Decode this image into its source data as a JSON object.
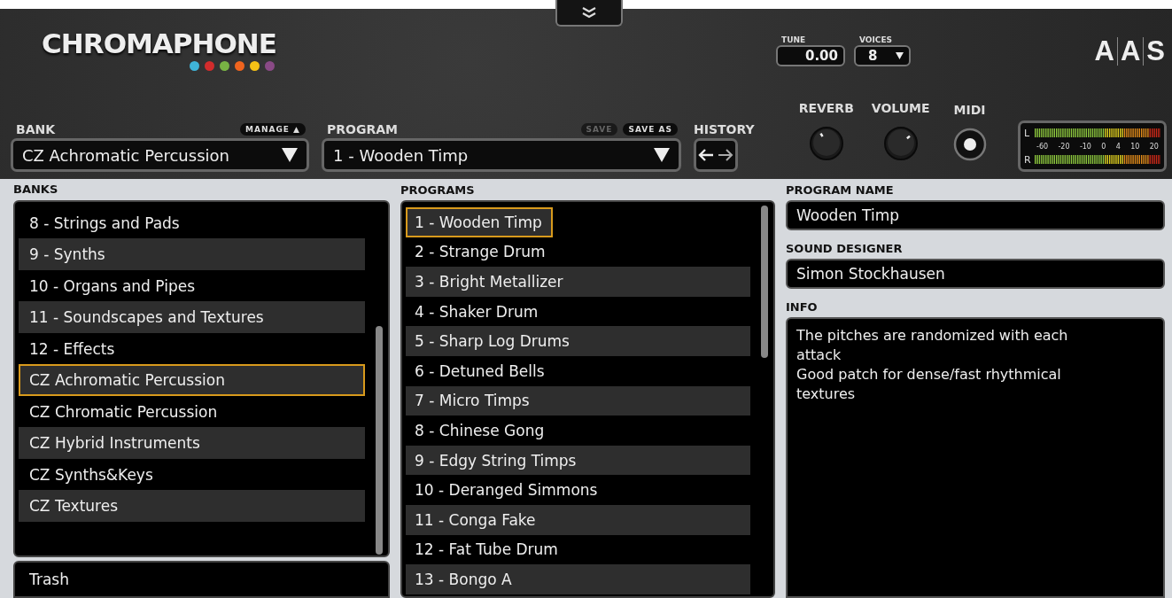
{
  "header": {
    "logo": "CHROMAPHONE",
    "logo_dots": [
      {
        "color": "#3fb4d8"
      },
      {
        "color": "#d22c2c"
      },
      {
        "color": "#78b344"
      },
      {
        "color": "#f0641e"
      },
      {
        "color": "#f5c116"
      },
      {
        "color": "#8a4a86"
      }
    ],
    "tune": {
      "label": "TUNE",
      "value": "0.00"
    },
    "voices": {
      "label": "VOICES",
      "value": "8"
    },
    "brand": [
      "A",
      "A",
      "S"
    ],
    "bank": {
      "label": "BANK",
      "manage": "MANAGE ▲",
      "value": "CZ Achromatic Percussion"
    },
    "program": {
      "label": "PROGRAM",
      "buttons": [
        {
          "label": "SAVE",
          "disabled": true
        },
        {
          "label": "SAVE AS",
          "disabled": false
        }
      ],
      "value": "1 - Wooden Timp"
    },
    "history": {
      "label": "HISTORY"
    },
    "knobs": [
      {
        "label": "REVERB"
      },
      {
        "label": "VOLUME"
      }
    ],
    "midi": {
      "label": "MIDI"
    },
    "meter": {
      "channels": [
        "L",
        "R"
      ],
      "scale": [
        "-60",
        "-20",
        "-10",
        "0",
        "4",
        "10",
        "20"
      ]
    }
  },
  "banks": {
    "title": "BANKS",
    "items": [
      {
        "label": "8 - Strings and Pads",
        "selected": false
      },
      {
        "label": "9 - Synths",
        "selected": false
      },
      {
        "label": "10 - Organs and Pipes",
        "selected": false
      },
      {
        "label": "11 - Soundscapes and Textures",
        "selected": false
      },
      {
        "label": "12 - Effects",
        "selected": false
      },
      {
        "label": "CZ Achromatic Percussion",
        "selected": true
      },
      {
        "label": "CZ Chromatic Percussion",
        "selected": false
      },
      {
        "label": "CZ Hybrid Instruments",
        "selected": false
      },
      {
        "label": "CZ Synths&Keys",
        "selected": false
      },
      {
        "label": "CZ Textures",
        "selected": false
      }
    ],
    "trash": "Trash"
  },
  "programs": {
    "title": "PROGRAMS",
    "items": [
      {
        "label": "1 - Wooden Timp",
        "selected": true
      },
      {
        "label": "2 - Strange Drum",
        "selected": false
      },
      {
        "label": "3 - Bright Metallizer",
        "selected": false
      },
      {
        "label": "4 - Shaker Drum",
        "selected": false
      },
      {
        "label": "5 - Sharp Log Drums",
        "selected": false
      },
      {
        "label": "6 - Detuned Bells",
        "selected": false
      },
      {
        "label": "7 - Micro Timps",
        "selected": false
      },
      {
        "label": "8 - Chinese Gong",
        "selected": false
      },
      {
        "label": "9 - Edgy String Timps",
        "selected": false
      },
      {
        "label": "10 - Deranged Simmons",
        "selected": false
      },
      {
        "label": "11 - Conga Fake",
        "selected": false
      },
      {
        "label": "12 - Fat Tube Drum",
        "selected": false
      },
      {
        "label": "13 - Bongo A",
        "selected": false
      }
    ]
  },
  "details": {
    "program_name": {
      "label": "PROGRAM NAME",
      "value": "Wooden Timp"
    },
    "sound_designer": {
      "label": "SOUND DESIGNER",
      "value": "Simon Stockhausen"
    },
    "info": {
      "label": "INFO",
      "lines": [
        "The pitches are randomized with each attack",
        "Good patch for dense/fast rhythmical textures"
      ]
    }
  }
}
